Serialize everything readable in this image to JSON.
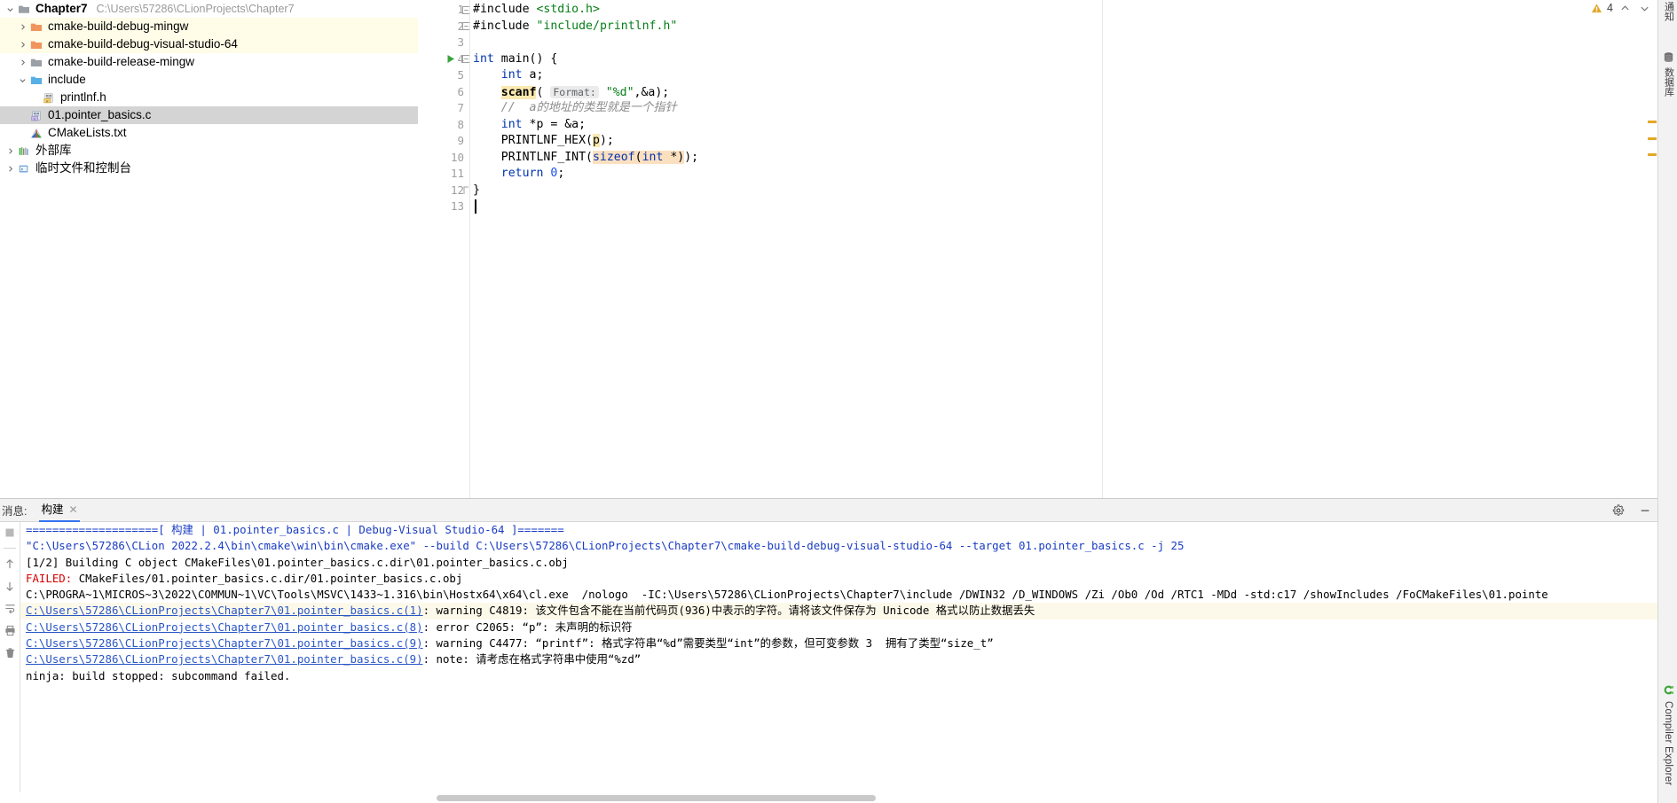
{
  "project_tree": {
    "root": {
      "label": "Chapter7",
      "path": "C:\\Users\\57286\\CLionProjects\\Chapter7",
      "expanded": true
    },
    "items": [
      {
        "label": "cmake-build-debug-mingw",
        "icon": "folder-orange-icon",
        "indent": 1,
        "expandable": true,
        "expanded": false,
        "state": "highlight"
      },
      {
        "label": "cmake-build-debug-visual-studio-64",
        "icon": "folder-orange-icon",
        "indent": 1,
        "expandable": true,
        "expanded": false,
        "state": "highlight"
      },
      {
        "label": "cmake-build-release-mingw",
        "icon": "folder-gray-icon",
        "indent": 1,
        "expandable": true,
        "expanded": false,
        "state": "none"
      },
      {
        "label": "include",
        "icon": "folder-blue-icon",
        "indent": 1,
        "expandable": true,
        "expanded": true,
        "state": "none"
      },
      {
        "label": "printlnf.h",
        "icon": "h-file-icon",
        "indent": 2,
        "expandable": false,
        "expanded": false,
        "state": "none"
      },
      {
        "label": "01.pointer_basics.c",
        "icon": "c-file-icon",
        "indent": 1,
        "expandable": false,
        "expanded": false,
        "state": "selected"
      },
      {
        "label": "CMakeLists.txt",
        "icon": "cmake-file-icon",
        "indent": 1,
        "expandable": false,
        "expanded": false,
        "state": "none"
      },
      {
        "label": "外部库",
        "icon": "external-libraries-icon",
        "indent": 0,
        "expandable": true,
        "expanded": false,
        "state": "none"
      },
      {
        "label": "临时文件和控制台",
        "icon": "scratches-icon",
        "indent": 0,
        "expandable": true,
        "expanded": false,
        "state": "none"
      }
    ]
  },
  "editor": {
    "line_numbers": [
      "1",
      "2",
      "3",
      "4",
      "5",
      "6",
      "7",
      "8",
      "9",
      "10",
      "11",
      "12",
      "13"
    ],
    "lines": [
      "#include <stdio.h>",
      "#include \"include/printlnf.h\"",
      "",
      "int main() {",
      "    int a;",
      "    scanf( Format: \"%d\",&a);",
      "    //  a的地址的类型就是一个指针",
      "    int *p = &a;",
      "    PRINTLNF_HEX(p);",
      "    PRINTLNF_INT(sizeof(int *));",
      "    return 0;",
      "}",
      ""
    ],
    "inline_hint_label": "Format:",
    "run_gutter_line": 4,
    "caret_line": 13
  },
  "inspections": {
    "warning_count": "4",
    "warning_icon": "warning-triangle-icon",
    "up_icon": "chevron-up-icon",
    "down_icon": "chevron-down-icon"
  },
  "right_strip": {
    "tools": [
      {
        "label": "通知",
        "icon": "notifications-icon",
        "orientation": "vertical-cn"
      },
      {
        "label": "数据库",
        "icon": "database-icon",
        "orientation": "vertical-cn"
      },
      {
        "label": "Compiler Explorer",
        "icon": "compiler-explorer-icon",
        "orientation": "vertical-en"
      }
    ]
  },
  "build_panel": {
    "title": "消息:",
    "tab_label": "构建",
    "tab_close_icon": "close-icon",
    "settings_icon": "gear-icon",
    "minimize_icon": "minimize-icon",
    "toolbar_icons": [
      "stop-icon",
      "rerun-icon",
      "prev-occurrence-icon",
      "next-occurrence-icon",
      "soft-wrap-icon",
      "print-icon",
      "clear-all-icon"
    ],
    "output": [
      {
        "segments": [
          {
            "text": "====================[ ",
            "style": "blue"
          },
          {
            "text": "构建",
            "style": "blue"
          },
          {
            "text": " | 01.pointer_basics.c | Debug-Visual Studio-64 ]=======",
            "style": "blue"
          }
        ],
        "bg": "none"
      },
      {
        "segments": [
          {
            "text": "\"C:\\Users\\57286\\CLion 2022.2.4\\bin\\cmake\\win\\bin\\cmake.exe\" --build C:\\Users\\57286\\CLionProjects\\Chapter7\\cmake-build-debug-visual-studio-64 --target 01.pointer_basics.c -j 25",
            "style": "blue"
          }
        ],
        "bg": "none"
      },
      {
        "segments": [
          {
            "text": "[1/2] Building C object CMakeFiles\\01.pointer_basics.c.dir\\01.pointer_basics.c.obj",
            "style": "blk"
          }
        ],
        "bg": "none"
      },
      {
        "segments": [
          {
            "text": "FAILED: ",
            "style": "red"
          },
          {
            "text": "CMakeFiles/01.pointer_basics.c.dir/01.pointer_basics.c.obj",
            "style": "blk"
          }
        ],
        "bg": "none"
      },
      {
        "segments": [
          {
            "text": "C:\\PROGRA~1\\MICROS~3\\2022\\COMMUN~1\\VC\\Tools\\MSVC\\1433~1.316\\bin\\Hostx64\\x64\\cl.exe  /nologo  -IC:\\Users\\57286\\CLionProjects\\Chapter7\\include /DWIN32 /D_WINDOWS /Zi /Ob0 /Od /RTC1 -MDd -std:c17 /showIncludes /FoCMakeFiles\\01.pointe",
            "style": "blk"
          }
        ],
        "bg": "none"
      },
      {
        "segments": [
          {
            "text": "C:\\Users\\57286\\CLionProjects\\Chapter7\\01.pointer_basics.c(1)",
            "style": "link"
          },
          {
            "text": ": warning C4819: 该文件包含不能在当前代码页(936)中表示的字符。请将该文件保存为 Unicode 格式以防止数据丢失",
            "style": "blk"
          }
        ],
        "bg": "warn"
      },
      {
        "segments": [
          {
            "text": "C:\\Users\\57286\\CLionProjects\\Chapter7\\01.pointer_basics.c(8)",
            "style": "link"
          },
          {
            "text": ": error C2065: “p”: 未声明的标识符",
            "style": "blk"
          }
        ],
        "bg": "none"
      },
      {
        "segments": [
          {
            "text": "C:\\Users\\57286\\CLionProjects\\Chapter7\\01.pointer_basics.c(9)",
            "style": "link"
          },
          {
            "text": ": warning C4477: “printf”: 格式字符串“%d”需要类型“int”的参数，但可变参数 3  拥有了类型“size_t”",
            "style": "blk"
          }
        ],
        "bg": "none"
      },
      {
        "segments": [
          {
            "text": "C:\\Users\\57286\\CLionProjects\\Chapter7\\01.pointer_basics.c(9)",
            "style": "link"
          },
          {
            "text": ": note: 请考虑在格式字符串中使用“%zd”",
            "style": "blk"
          }
        ],
        "bg": "none"
      },
      {
        "segments": [
          {
            "text": "ninja: build stopped: subcommand failed.",
            "style": "blk"
          }
        ],
        "bg": "none"
      }
    ]
  },
  "colors": {
    "accent": "#3574f0",
    "warning": "#e3a82b",
    "error": "#d90000",
    "link": "#2a56c6",
    "keyword": "#0033b3",
    "string": "#067d17",
    "comment": "#8c8c8c",
    "selection": "#d4d4d4",
    "highlight_row": "#fffce8"
  }
}
